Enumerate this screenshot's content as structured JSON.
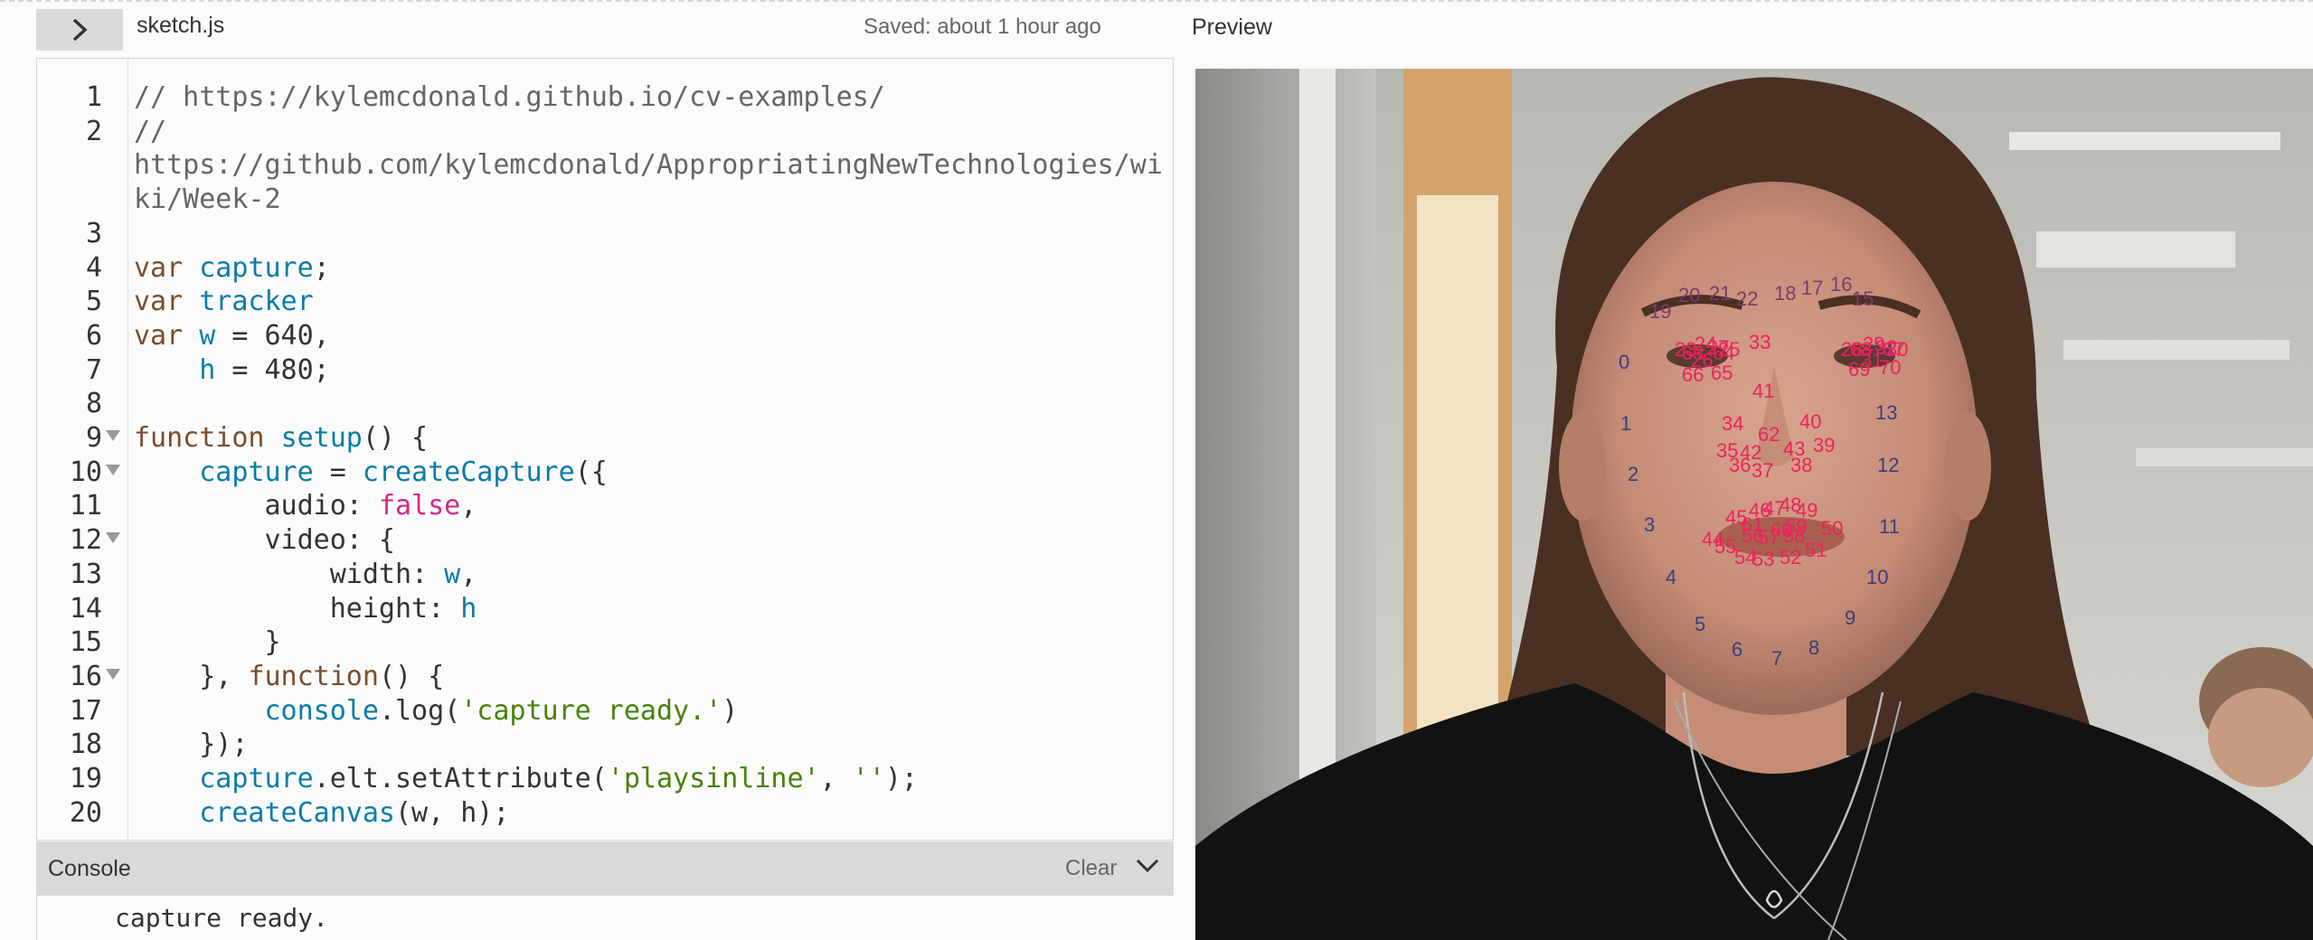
{
  "header": {
    "filename": "sketch.js",
    "saved_status": "Saved: about 1 hour ago",
    "preview_label": "Preview"
  },
  "editor": {
    "lines": [
      {
        "n": "1",
        "tokens": [
          {
            "t": "// https://kylemcdonald.github.io/cv-examples/",
            "c": "cm"
          }
        ]
      },
      {
        "n": "2",
        "tokens": [
          {
            "t": "//",
            "c": "cm"
          }
        ]
      },
      {
        "n": "",
        "tokens": [
          {
            "t": "https://github.com/kylemcdonald/AppropriatingNewTechnologies/wi",
            "c": "cm"
          }
        ]
      },
      {
        "n": "",
        "tokens": [
          {
            "t": "ki/Week-2",
            "c": "cm"
          }
        ]
      },
      {
        "n": "3",
        "tokens": []
      },
      {
        "n": "4",
        "tokens": [
          {
            "t": "var ",
            "c": "kw"
          },
          {
            "t": "capture",
            "c": "fn"
          },
          {
            "t": ";",
            "c": ""
          }
        ]
      },
      {
        "n": "5",
        "tokens": [
          {
            "t": "var ",
            "c": "kw"
          },
          {
            "t": "tracker",
            "c": "fn"
          }
        ]
      },
      {
        "n": "6",
        "tokens": [
          {
            "t": "var ",
            "c": "kw"
          },
          {
            "t": "w",
            "c": "fn"
          },
          {
            "t": " = 640,",
            "c": ""
          }
        ]
      },
      {
        "n": "7",
        "tokens": [
          {
            "t": "    ",
            "c": ""
          },
          {
            "t": "h",
            "c": "fn"
          },
          {
            "t": " = 480;",
            "c": ""
          }
        ]
      },
      {
        "n": "8",
        "tokens": []
      },
      {
        "n": "9",
        "fold": true,
        "tokens": [
          {
            "t": "function ",
            "c": "kw"
          },
          {
            "t": "setup",
            "c": "fn"
          },
          {
            "t": "() {",
            "c": ""
          }
        ]
      },
      {
        "n": "10",
        "fold": true,
        "tokens": [
          {
            "t": "    ",
            "c": ""
          },
          {
            "t": "capture",
            "c": "fn"
          },
          {
            "t": " = ",
            "c": ""
          },
          {
            "t": "createCapture",
            "c": "fn"
          },
          {
            "t": "({",
            "c": ""
          }
        ]
      },
      {
        "n": "11",
        "tokens": [
          {
            "t": "        audio: ",
            "c": ""
          },
          {
            "t": "false",
            "c": "bool"
          },
          {
            "t": ",",
            "c": ""
          }
        ]
      },
      {
        "n": "12",
        "fold": true,
        "tokens": [
          {
            "t": "        video: {",
            "c": ""
          }
        ]
      },
      {
        "n": "13",
        "tokens": [
          {
            "t": "            width: ",
            "c": ""
          },
          {
            "t": "w",
            "c": "fn"
          },
          {
            "t": ",",
            "c": ""
          }
        ]
      },
      {
        "n": "14",
        "tokens": [
          {
            "t": "            height: ",
            "c": ""
          },
          {
            "t": "h",
            "c": "fn"
          }
        ]
      },
      {
        "n": "15",
        "tokens": [
          {
            "t": "        }",
            "c": ""
          }
        ]
      },
      {
        "n": "16",
        "fold": true,
        "tokens": [
          {
            "t": "    }, ",
            "c": ""
          },
          {
            "t": "function",
            "c": "kw"
          },
          {
            "t": "() {",
            "c": ""
          }
        ]
      },
      {
        "n": "17",
        "tokens": [
          {
            "t": "        ",
            "c": ""
          },
          {
            "t": "console",
            "c": "fn"
          },
          {
            "t": ".log(",
            "c": ""
          },
          {
            "t": "'capture ready.'",
            "c": "str"
          },
          {
            "t": ")",
            "c": ""
          }
        ]
      },
      {
        "n": "18",
        "tokens": [
          {
            "t": "    });",
            "c": ""
          }
        ]
      },
      {
        "n": "19",
        "tokens": [
          {
            "t": "    ",
            "c": ""
          },
          {
            "t": "capture",
            "c": "fn"
          },
          {
            "t": ".elt.setAttribute(",
            "c": ""
          },
          {
            "t": "'playsinline'",
            "c": "str"
          },
          {
            "t": ", ",
            "c": ""
          },
          {
            "t": "''",
            "c": "str"
          },
          {
            "t": ");",
            "c": ""
          }
        ]
      },
      {
        "n": "20",
        "tokens": [
          {
            "t": "    ",
            "c": ""
          },
          {
            "t": "createCanvas",
            "c": "fn"
          },
          {
            "t": "(w, h);",
            "c": ""
          }
        ]
      }
    ]
  },
  "console": {
    "title": "Console",
    "clear_label": "Clear",
    "output": "capture ready."
  },
  "colors": {
    "accent_pink": "#ed225d",
    "keyword": "#7a4e2d",
    "identifier": "#0b7ca9",
    "string": "#47820a",
    "boolean": "#d52889"
  },
  "face_points": {
    "dark_labels": [
      "0",
      "1",
      "2",
      "3",
      "4",
      "5",
      "6",
      "7",
      "8",
      "9",
      "10",
      "11",
      "12",
      "13",
      "14"
    ],
    "mid_labels": [
      "15",
      "16",
      "17",
      "18",
      "19",
      "20",
      "21",
      "22"
    ],
    "pink_labels": [
      "23",
      "24",
      "25",
      "26",
      "27",
      "28",
      "29",
      "30",
      "31",
      "32",
      "33",
      "34",
      "35",
      "36",
      "37",
      "38",
      "39",
      "40",
      "41",
      "42",
      "43",
      "44",
      "45",
      "46",
      "47",
      "48",
      "49",
      "50",
      "51",
      "52",
      "53",
      "54",
      "55",
      "56",
      "57",
      "58",
      "59",
      "60",
      "61",
      "62",
      "63",
      "64",
      "65",
      "66",
      "67",
      "68",
      "69",
      "70"
    ]
  }
}
